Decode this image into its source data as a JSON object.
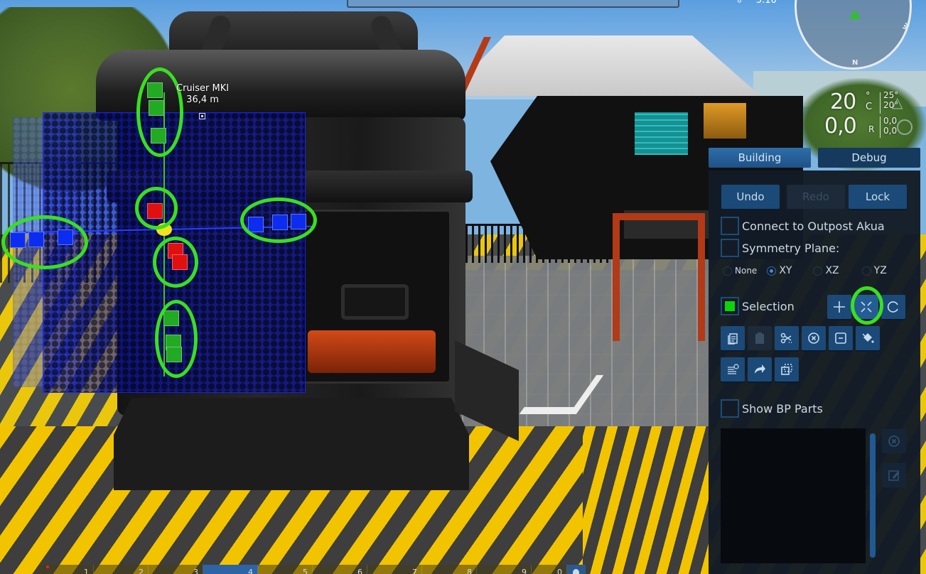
{
  "scene": {
    "vessel_label": {
      "name": "Cruiser MKI",
      "distance": "36,4 m"
    }
  },
  "hud": {
    "coords": {
      "icon": "download-arrow-icon",
      "value": "5.10"
    },
    "compass": {
      "north_label": "N",
      "west_label": "W"
    },
    "temperature": {
      "value": "20",
      "degree": "°",
      "unit": "C",
      "high": "25°",
      "low": "20°"
    },
    "radiation": {
      "value": "0,0",
      "unit": "R",
      "top": "0,0",
      "bottom": "0,0"
    }
  },
  "panel": {
    "tabs": [
      {
        "label": "Building",
        "active": true
      },
      {
        "label": "Debug",
        "active": false
      }
    ],
    "actions": {
      "undo": "Undo",
      "redo": "Redo",
      "lock": "Lock"
    },
    "connect_outpost": {
      "label": "Connect to Outpost Akua",
      "checked": false
    },
    "symmetry_plane": {
      "label": "Symmetry Plane:",
      "checked": false,
      "options": [
        "None",
        "XY",
        "XZ",
        "YZ"
      ],
      "selected": "XY"
    },
    "selection": {
      "label": "Selection",
      "checked": true,
      "modes": [
        {
          "icon": "move-icon",
          "active": false
        },
        {
          "icon": "scale-icon",
          "active": true
        },
        {
          "icon": "rotate-icon",
          "active": false
        }
      ]
    },
    "tools_row1": [
      {
        "icon": "copy-icon",
        "enabled": true
      },
      {
        "icon": "paste-icon",
        "enabled": false
      },
      {
        "icon": "cut-icon",
        "enabled": true
      },
      {
        "icon": "delete-circle-icon",
        "enabled": true
      },
      {
        "icon": "minus-square-icon",
        "enabled": true
      },
      {
        "icon": "paint-bucket-icon",
        "enabled": true
      }
    ],
    "tools_row2": [
      {
        "icon": "list-check-icon",
        "enabled": true
      },
      {
        "icon": "share-arrow-icon",
        "enabled": true
      },
      {
        "icon": "duplicate-icon",
        "enabled": true
      }
    ],
    "show_bp_parts": {
      "label": "Show BP Parts",
      "checked": false
    },
    "bp_list_side": [
      {
        "icon": "remove-circle-icon",
        "enabled": false
      },
      {
        "icon": "edit-icon",
        "enabled": false
      }
    ]
  },
  "hotbar": {
    "slots": [
      "1",
      "2",
      "3",
      "4",
      "5",
      "6",
      "7",
      "8",
      "9",
      "0"
    ],
    "active_slot": "4"
  },
  "annotation": {
    "highlight_color": "#39e01f"
  }
}
